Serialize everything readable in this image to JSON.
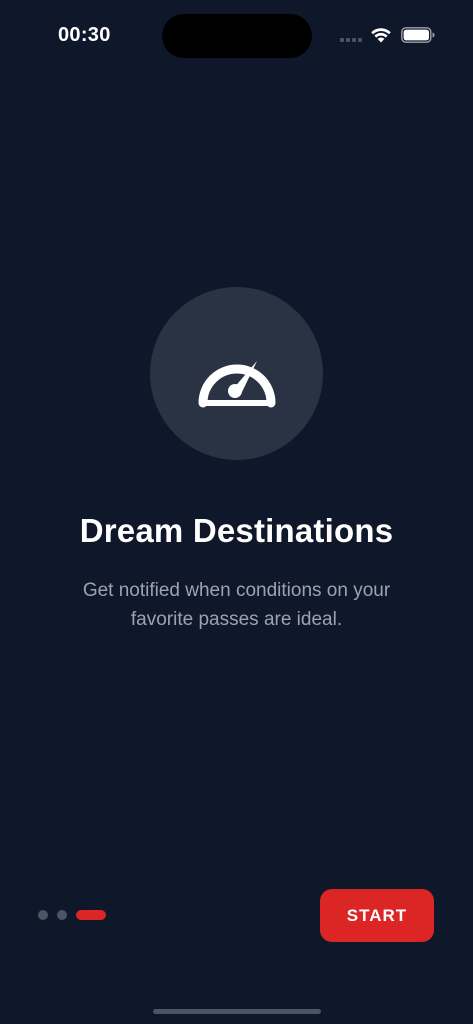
{
  "status_bar": {
    "time": "00:30",
    "signal_icon": "cellular-signal-icon",
    "wifi_icon": "wifi-icon",
    "battery_icon": "battery-icon"
  },
  "hero": {
    "icon": "speedometer-icon"
  },
  "onboarding": {
    "title": "Dream Destinations",
    "subtitle": "Get notified when conditions on your favorite passes are ideal."
  },
  "pager": {
    "total_pages": 3,
    "current_page": 3
  },
  "actions": {
    "start_label": "START"
  },
  "colors": {
    "background": "#0f172a",
    "circle": "#293344",
    "accent": "#dc2626",
    "muted_text": "#9ca3af",
    "inactive_dot": "#4b5563"
  }
}
